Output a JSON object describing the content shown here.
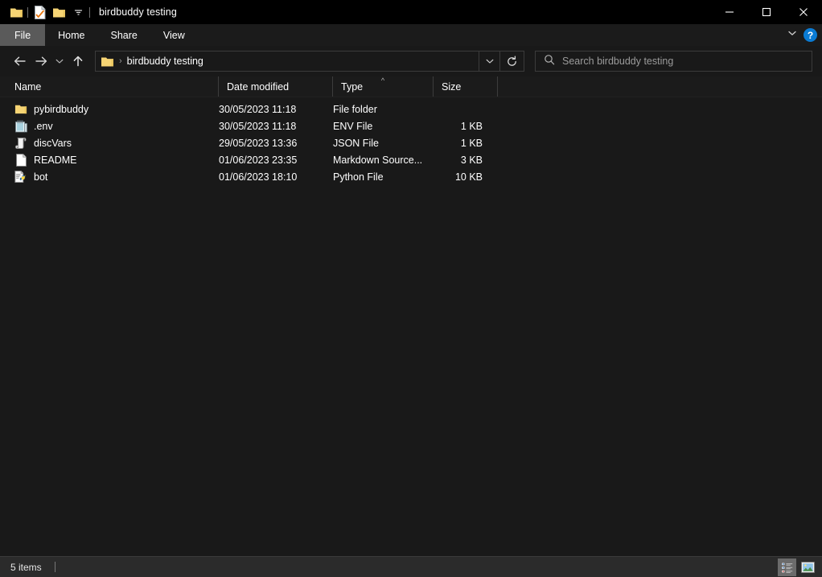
{
  "window": {
    "title": "birdbuddy testing",
    "controls": {
      "minimize": "minimize-button",
      "maximize": "maximize-button",
      "close": "close-button"
    }
  },
  "quick_access_toolbar": {
    "items": [
      {
        "icon": "folder-icon",
        "label": "Pin to Quick access"
      },
      {
        "icon": "properties-checkmark-icon",
        "label": "Properties"
      },
      {
        "icon": "new-folder-icon",
        "label": "New folder"
      },
      {
        "icon": "chevron-down-icon",
        "label": "Customize Quick Access Toolbar"
      }
    ]
  },
  "ribbon": {
    "tabs": [
      {
        "label": "File",
        "active": true
      },
      {
        "label": "Home",
        "active": false
      },
      {
        "label": "Share",
        "active": false
      },
      {
        "label": "View",
        "active": false
      }
    ],
    "expand_icon": "chevron-down-icon",
    "help_icon": "help-question-icon",
    "help_label": "?"
  },
  "navigation": {
    "back_icon": "arrow-left-icon",
    "forward_icon": "arrow-right-icon",
    "recent_icon": "chevron-down-icon",
    "up_icon": "arrow-up-icon",
    "breadcrumb": {
      "folder_icon": "folder-icon",
      "separator": "›",
      "path": "birdbuddy testing"
    },
    "address_dropdown_icon": "chevron-down-icon",
    "refresh_icon": "refresh-icon"
  },
  "search": {
    "icon": "search-icon",
    "placeholder": "Search birdbuddy testing",
    "value": ""
  },
  "columns": [
    {
      "key": "name",
      "label": "Name",
      "sorted": false
    },
    {
      "key": "date",
      "label": "Date modified",
      "sorted": false
    },
    {
      "key": "type",
      "label": "Type",
      "sorted": true,
      "sort_direction": "ascending",
      "sort_glyph": "^"
    },
    {
      "key": "size",
      "label": "Size",
      "sorted": false
    }
  ],
  "files": [
    {
      "name": "pybirdbuddy",
      "date_modified": "30/05/2023 11:18",
      "type": "File folder",
      "size": "",
      "icon": "folder-icon"
    },
    {
      "name": ".env",
      "date_modified": "30/05/2023 11:18",
      "type": "ENV File",
      "size": "1 KB",
      "icon": "notepad-file-icon"
    },
    {
      "name": "discVars",
      "date_modified": "29/05/2023 13:36",
      "type": "JSON File",
      "size": "1 KB",
      "icon": "json-scroll-file-icon"
    },
    {
      "name": "README",
      "date_modified": "01/06/2023 23:35",
      "type": "Markdown Source...",
      "size": "3 KB",
      "icon": "blank-document-icon"
    },
    {
      "name": "bot",
      "date_modified": "01/06/2023 18:10",
      "type": "Python File",
      "size": "10 KB",
      "icon": "python-file-icon"
    }
  ],
  "status_bar": {
    "item_count_text": "5 items",
    "views": [
      {
        "name": "details-view",
        "label": "Details view",
        "active": true
      },
      {
        "name": "large-icons-view",
        "label": "Large icons view",
        "active": false
      }
    ]
  },
  "colors": {
    "window_background": "#191919",
    "titlebar_background": "#000000",
    "ribbon_background": "#1b1b1b",
    "active_tab_background": "#5a5a5a",
    "statusbar_background": "#2b2b2b",
    "text_primary": "#ffffff",
    "text_muted": "#9b9b9b",
    "border": "#3b3b3b",
    "folder_yellow": "#f6d474",
    "help_blue": "#0a7bd4"
  }
}
